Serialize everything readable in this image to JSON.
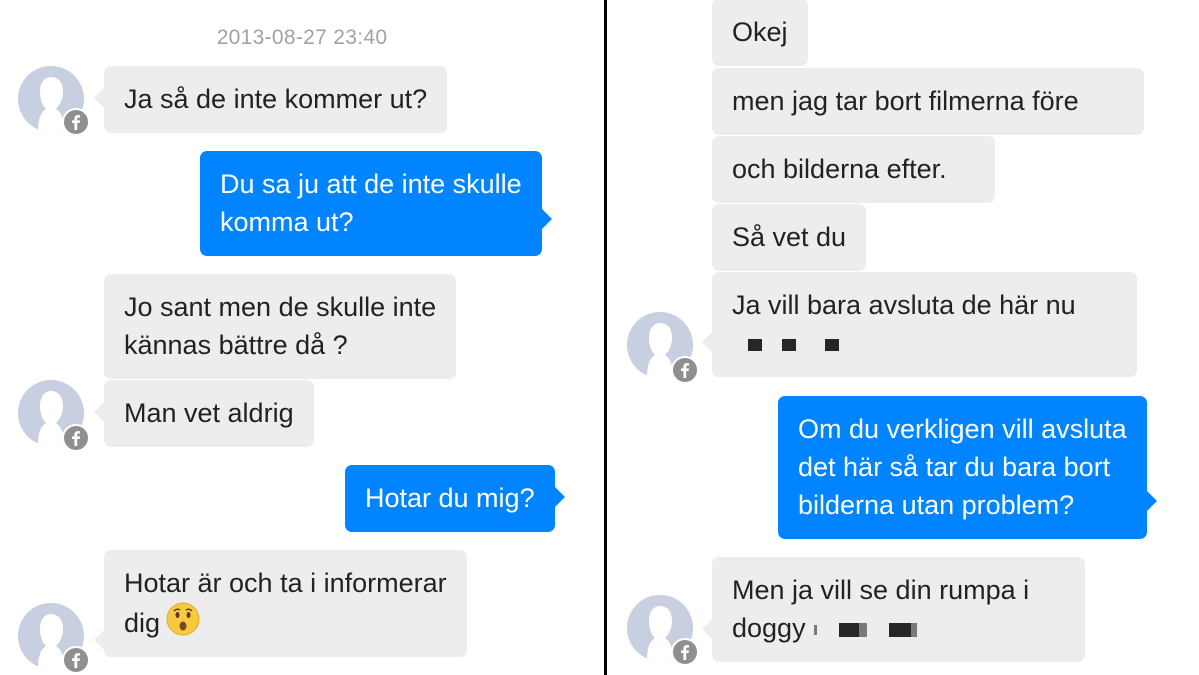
{
  "left": {
    "timestamp": "2013-08-27 23:40",
    "messages": [
      {
        "direction": "in",
        "lines": [
          "Ja så de inte kommer ut?"
        ]
      },
      {
        "direction": "out",
        "lines": [
          "Du sa ju att de inte skulle",
          "komma ut?"
        ]
      },
      {
        "direction": "in",
        "lines": [
          "Jo sant men de skulle inte",
          "kännas bättre då ?"
        ]
      },
      {
        "direction": "in",
        "lines": [
          "Man vet aldrig"
        ]
      },
      {
        "direction": "out",
        "lines": [
          "Hotar du mig?"
        ]
      },
      {
        "direction": "in",
        "lines": [
          "Hotar är och ta i informerar",
          "dig"
        ],
        "emoji": "hushed-face-emoji"
      }
    ]
  },
  "right": {
    "messages": [
      {
        "direction": "in",
        "lines": [
          "Okej"
        ]
      },
      {
        "direction": "in",
        "lines": [
          "men jag tar bort filmerna före"
        ]
      },
      {
        "direction": "in",
        "lines": [
          "och bilderna efter."
        ]
      },
      {
        "direction": "in",
        "lines": [
          "Så vet du"
        ]
      },
      {
        "direction": "in",
        "lines": [
          "Ja vill bara avsluta de här nu"
        ],
        "redacted": true
      },
      {
        "direction": "out",
        "lines": [
          "Om du verkligen vill avsluta",
          "det här så tar du bara bort",
          "bilderna utan problem?"
        ]
      },
      {
        "direction": "in",
        "lines": [
          "Men ja vill se din rumpa i",
          "doggy"
        ],
        "redacted": true
      }
    ]
  },
  "icons": {
    "avatar": "default-profile-silhouette-icon",
    "badge": "facebook-badge-icon"
  },
  "colors": {
    "incoming_bubble": "#ededed",
    "outgoing_bubble": "#0084ff",
    "timestamp": "#a2a2a2",
    "divider": "#000000"
  }
}
